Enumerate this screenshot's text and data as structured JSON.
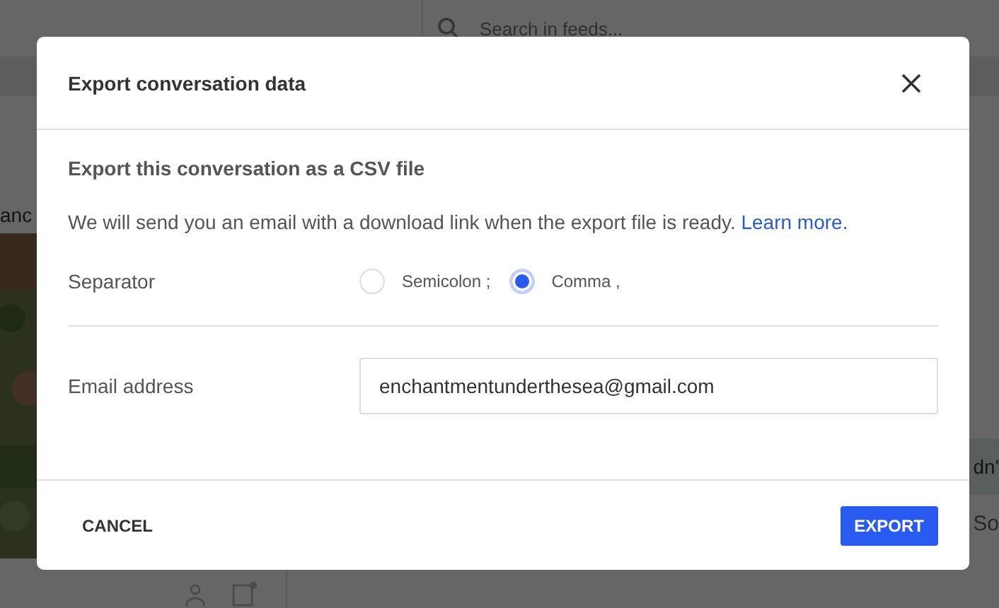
{
  "background": {
    "search": {
      "placeholder": "Search in feeds..."
    },
    "left_text": "anc",
    "right_texts": [
      "dn'",
      "So"
    ]
  },
  "dialog": {
    "title": "Export conversation data",
    "heading": "Export this conversation as a CSV file",
    "message": "We will send you an email with a download link when the export file is ready.",
    "link": "Learn more.",
    "separator": {
      "label": "Separator",
      "options": [
        {
          "label": "Semicolon ;",
          "selected": false
        },
        {
          "label": "Comma ,",
          "selected": true
        }
      ]
    },
    "email": {
      "label": "Email address",
      "value": "enchantmentunderthesea@gmail.com"
    },
    "buttons": [
      {
        "label": "CANCEL",
        "kind": "text"
      },
      {
        "label": "EXPORT",
        "kind": "primary"
      }
    ]
  }
}
